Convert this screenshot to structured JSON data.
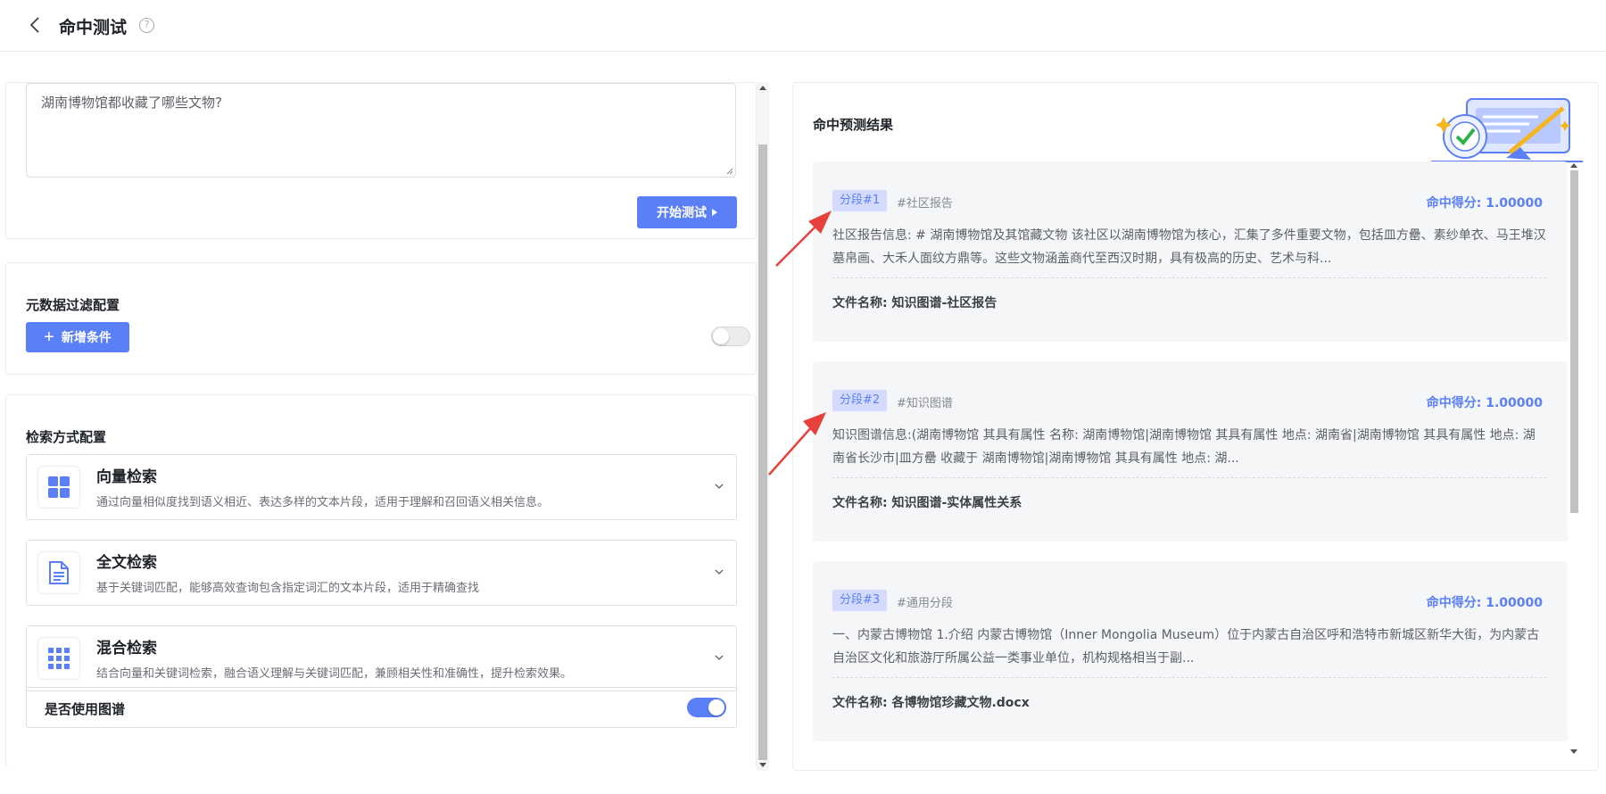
{
  "header": {
    "title": "命中测试",
    "help_glyph": "?"
  },
  "query": {
    "text": "湖南博物馆都收藏了哪些文物?",
    "start_label": "开始测试"
  },
  "metadata_filter": {
    "title": "元数据过滤配置",
    "add_label": "新增条件",
    "enabled": false
  },
  "retrieval": {
    "title": "检索方式配置",
    "methods": [
      {
        "title": "向量检索",
        "desc": "通过向量相似度找到语义相近、表达多样的文本片段，适用于理解和召回语义相关信息。",
        "icon": "grid-icon"
      },
      {
        "title": "全文检索",
        "desc": "基于关键词匹配，能够高效查询包含指定词汇的文本片段，适用于精确查找",
        "icon": "document-icon"
      },
      {
        "title": "混合检索",
        "desc": "结合向量和关键词检索，融合语义理解与关键词匹配，兼顾相关性和准确性，提升检索效果。",
        "icon": "dots-grid-icon"
      }
    ],
    "use_graph_label": "是否使用图谱",
    "use_graph": true
  },
  "results": {
    "title": "命中预测结果",
    "items": [
      {
        "tag": "分段#1",
        "hash": "#社区报告",
        "score": "命中得分: 1.00000",
        "text": "社区报告信息: # 湖南博物馆及其馆藏文物 该社区以湖南博物馆为核心，汇集了多件重要文物，包括皿方罍、素纱单衣、马王堆汉墓帛画、大禾人面纹方鼎等。这些文物涵盖商代至西汉时期，具有极高的历史、艺术与科...",
        "file": "文件名称: 知识图谱-社区报告"
      },
      {
        "tag": "分段#2",
        "hash": "#知识图谱",
        "score": "命中得分: 1.00000",
        "text": "知识图谱信息:(湖南博物馆 其具有属性 名称: 湖南博物馆|湖南博物馆 其具有属性 地点: 湖南省|湖南博物馆 其具有属性 地点: 湖南省长沙市|皿方罍 收藏于 湖南博物馆|湖南博物馆 其具有属性 地点: 湖...",
        "file": "文件名称: 知识图谱-实体属性关系"
      },
      {
        "tag": "分段#3",
        "hash": "#通用分段",
        "score": "命中得分: 1.00000",
        "text": "一、内蒙古博物馆 1.介绍 内蒙古博物馆（Inner Mongolia Museum）位于内蒙古自治区呼和浩特市新城区新华大街，为内蒙古自治区文化和旅游厅所属公益一类事业单位，机构规格相当于副...",
        "file": "文件名称: 各博物馆珍藏文物.docx"
      }
    ]
  },
  "colors": {
    "primary": "#5b7ff7",
    "arrow": "#e8413c",
    "card_bg": "#f5f6f8"
  }
}
